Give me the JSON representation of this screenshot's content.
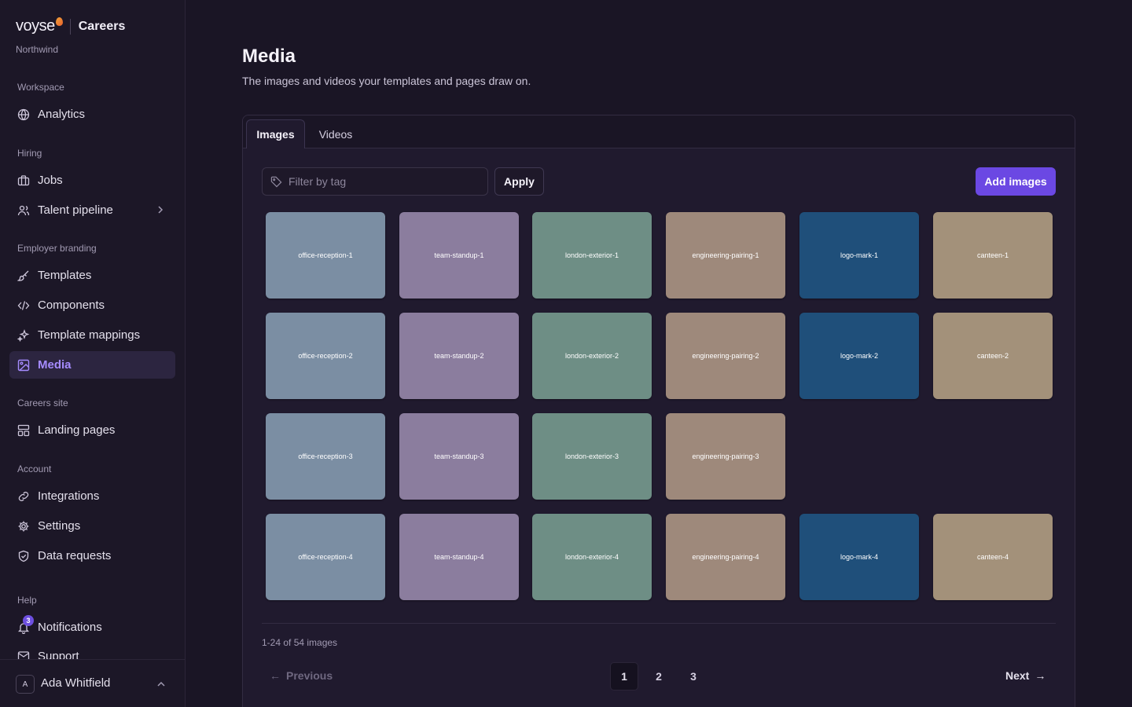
{
  "brand": {
    "logo": "voyse",
    "product": "Careers",
    "org": "Northwind"
  },
  "sidebar": {
    "sections": [
      {
        "label": "Workspace",
        "items": [
          {
            "label": "Analytics",
            "icon": "globe-icon"
          }
        ]
      },
      {
        "label": "Hiring",
        "items": [
          {
            "label": "Jobs",
            "icon": "briefcase-icon"
          },
          {
            "label": "Talent pipeline",
            "icon": "users-icon"
          }
        ]
      },
      {
        "label": "Employer branding",
        "items": [
          {
            "label": "Templates",
            "icon": "brush-icon"
          },
          {
            "label": "Components",
            "icon": "code-icon"
          },
          {
            "label": "Template mappings",
            "icon": "sparkles-icon"
          },
          {
            "label": "Media",
            "icon": "image-icon",
            "active": true
          }
        ]
      },
      {
        "label": "Careers site",
        "items": [
          {
            "label": "Landing pages",
            "icon": "layout-icon"
          }
        ]
      },
      {
        "label": "Account",
        "items": [
          {
            "label": "Integrations",
            "icon": "link-icon"
          },
          {
            "label": "Settings",
            "icon": "gear-icon"
          },
          {
            "label": "Data requests",
            "icon": "shield-icon"
          }
        ]
      },
      {
        "label": "Help",
        "items": [
          {
            "label": "Notifications",
            "icon": "bell-icon",
            "badge": "3"
          },
          {
            "label": "Support",
            "icon": "mail-icon"
          }
        ]
      }
    ],
    "user": {
      "initial": "A",
      "name": "Ada Whitfield"
    }
  },
  "page": {
    "title": "Media",
    "subtitle": "The images and videos your templates and pages draw on."
  },
  "tabs": [
    {
      "label": "Images",
      "active": true
    },
    {
      "label": "Videos",
      "active": false
    }
  ],
  "toolbar": {
    "filter_placeholder": "Filter by tag",
    "filter_value": "",
    "apply_label": "Apply",
    "add_label": "Add images"
  },
  "colors": {
    "office-reception": "#7b8ea3",
    "team-standup": "#8b7d9e",
    "london-exterior": "#6e8e85",
    "engineering-pairing": "#9e897b",
    "logo-mark": "#1f4f7a",
    "canteen": "#a3917a",
    "accent": "#6b48e3"
  },
  "grid_rows": [
    [
      "office-reception-1",
      "team-standup-1",
      "london-exterior-1",
      "engineering-pairing-1",
      "logo-mark-1",
      "canteen-1"
    ],
    [
      "office-reception-2",
      "team-standup-2",
      "london-exterior-2",
      "engineering-pairing-2",
      "logo-mark-2",
      "canteen-2"
    ],
    [
      "office-reception-3",
      "team-standup-3",
      "london-exterior-3",
      "engineering-pairing-3"
    ],
    [
      "office-reception-4",
      "team-standup-4",
      "london-exterior-4",
      "engineering-pairing-4",
      "logo-mark-4",
      "canteen-4"
    ]
  ],
  "pagination": {
    "summary": "1-24 of 54 images",
    "previous": "Previous",
    "next": "Next",
    "pages": [
      "1",
      "2",
      "3"
    ],
    "current": "1"
  }
}
